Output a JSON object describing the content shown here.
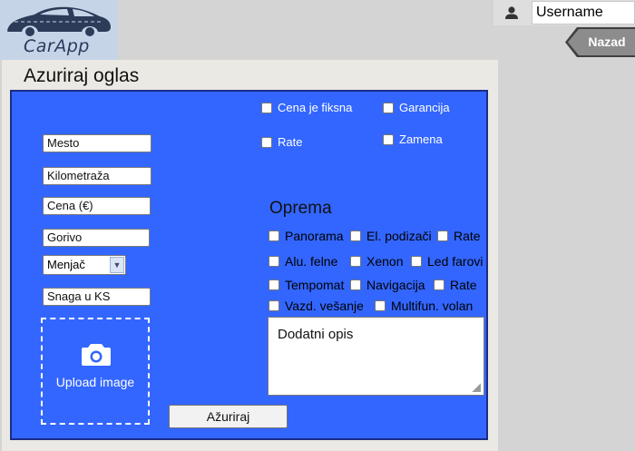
{
  "app": {
    "logo_text": "CarApp"
  },
  "header": {
    "username": "Username",
    "back_label": "Nazad"
  },
  "page": {
    "title": "Azuriraj oglas"
  },
  "form": {
    "mesto": "Mesto",
    "kilometraza": "Kilometraža",
    "cena": "Cena     (€)",
    "gorivo": "Gorivo",
    "menjac": "Menjač",
    "snaga": "Snaga u KS",
    "upload_label": "Upload image",
    "submit_label": "Ažuriraj",
    "options": {
      "cena_fiksna": "Cena je fiksna",
      "garancija": "Garancija",
      "rate": "Rate",
      "zamena": "Zamena"
    },
    "oprema_title": "Oprema",
    "oprema": {
      "panorama": "Panorama",
      "el_podizaci": "El. podizači",
      "rate": "Rate",
      "alu_felne": "Alu. felne",
      "xenon": "Xenon",
      "led_farovi": "Led farovi",
      "tempomat": "Tempomat",
      "navigacija": "Navigacija",
      "rate2": "Rate",
      "vazd_vesanje": "Vazd. vešanje",
      "multifun_volan": "Multifun. volan"
    },
    "opis": "Dodatni opis"
  },
  "colors": {
    "form_background": "#3366ff",
    "panel_background": "#ebe9e3",
    "page_background": "#d4d4d4",
    "back_button": "#8c8c8c"
  },
  "icons": [
    "car-logo-icon",
    "user-icon",
    "camera-icon",
    "chevron-down-icon"
  ]
}
